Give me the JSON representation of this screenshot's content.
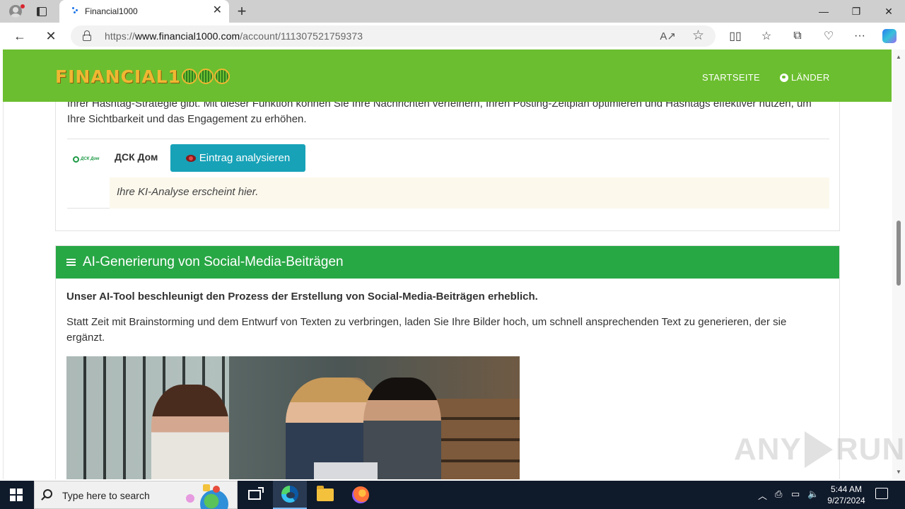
{
  "browser": {
    "tab_title": "Financial1000",
    "tab_close": "✕",
    "new_tab": "+",
    "url_prefix": "https://",
    "url_host": "www.financial1000.com",
    "url_path": "/account/111307521759373",
    "window_controls": {
      "minimize": "—",
      "maximize": "❐",
      "close": "✕"
    }
  },
  "site": {
    "logo_text": "FINANCIAL1",
    "nav": [
      {
        "label": "STARTSEITE"
      },
      {
        "label": "LÄNDER"
      }
    ]
  },
  "panel1": {
    "intro_text": "Ihrer Hashtag-Strategie gibt. Mit dieser Funktion können Sie Ihre Nachrichten verfeinern, Ihren Posting-Zeitplan optimieren und Hashtags effektiver nutzen, um Ihre Sichtbarkeit und das Engagement zu erhöhen.",
    "account_logo_text": "ДСК Дом",
    "account_name": "ДСК Дом",
    "analyze_button": "Eintrag analysieren",
    "result_placeholder": "Ihre KI-Analyse erscheint hier."
  },
  "panel2": {
    "title": "AI-Generierung von Social-Media-Beiträgen",
    "bold_text": "Unser AI-Tool beschleunigt den Prozess der Erstellung von Social-Media-Beiträgen erheblich.",
    "body_text": "Statt Zeit mit Brainstorming und dem Entwurf von Texten zu verbringen, laden Sie Ihre Bilder hoch, um schnell ansprechenden Text zu generieren, der sie ergänzt."
  },
  "watermark": {
    "left": "ANY",
    "right": "RUN"
  },
  "taskbar": {
    "search_placeholder": "Type here to search",
    "time": "5:44 AM",
    "date": "9/27/2024"
  },
  "colors": {
    "header_green": "#6bbe2f",
    "panel_header_green": "#28a745",
    "button_teal": "#17a2b8",
    "logo_gold": "#f0b732"
  }
}
